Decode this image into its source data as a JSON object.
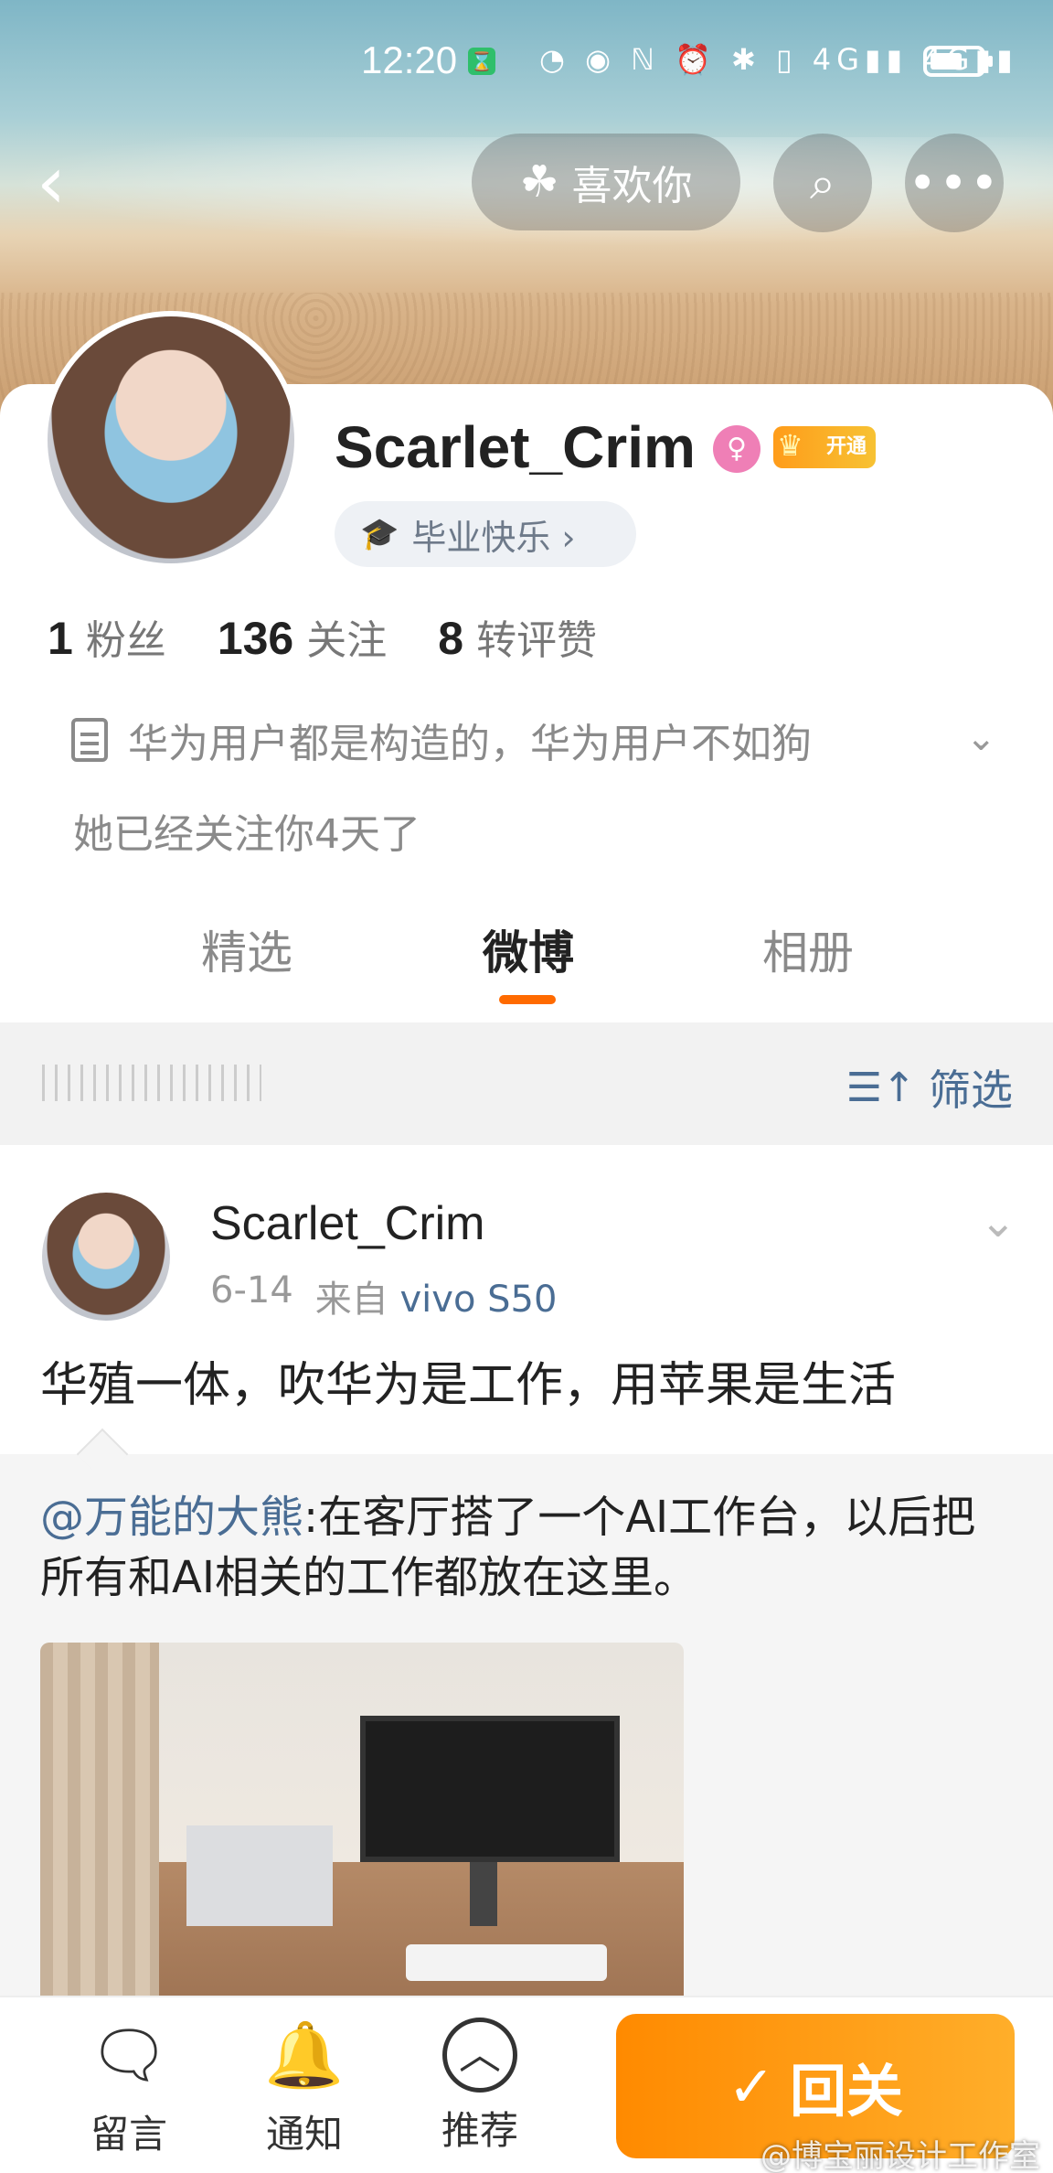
{
  "status_bar": {
    "time": "12:20",
    "icons": "◔ ◉ ℕ ⏰ ✱ ▯ 4G▮▮ 4G▮▮"
  },
  "header": {
    "back_icon": "back-chevron-icon",
    "like_label": "喜欢你",
    "search_icon": "search-icon",
    "more_icon": "more-icon"
  },
  "profile": {
    "username": "Scarlet_Crim",
    "vip_label": "开通",
    "tag_label": "毕业快乐 ›",
    "stats": [
      {
        "num": "1",
        "label": "粉丝"
      },
      {
        "num": "136",
        "label": "关注"
      },
      {
        "num": "8",
        "label": "转评赞"
      }
    ],
    "bio": "华为用户都是构造的，华为用户不如狗",
    "follow_note": "她已经关注你4天了"
  },
  "tabs": [
    "精选",
    "微博",
    "相册"
  ],
  "active_tab": "微博",
  "filter": {
    "label": "筛选"
  },
  "post": {
    "author": "Scarlet_Crim",
    "date": "6-14",
    "source_prefix": "来自",
    "device": "vivo S50",
    "text": "华殖一体，吹华为是工作，用苹果是生活",
    "repost": {
      "mention": "@万能的大熊",
      "text": ":在客厅搭了一个AI工作台，以后把所有和AI相关的工作都放在这里。"
    }
  },
  "bottom_bar": {
    "items": [
      {
        "label": "留言",
        "icon": "message-icon"
      },
      {
        "label": "通知",
        "icon": "bell-plus-icon"
      },
      {
        "label": "推荐",
        "icon": "recommend-icon"
      }
    ],
    "follow_back": "回关"
  },
  "watermark": "@博宝丽设计工作室",
  "colors": {
    "accent": "#ff8a00",
    "link": "#4a6d94",
    "active_indicator": "#ff6a00"
  }
}
